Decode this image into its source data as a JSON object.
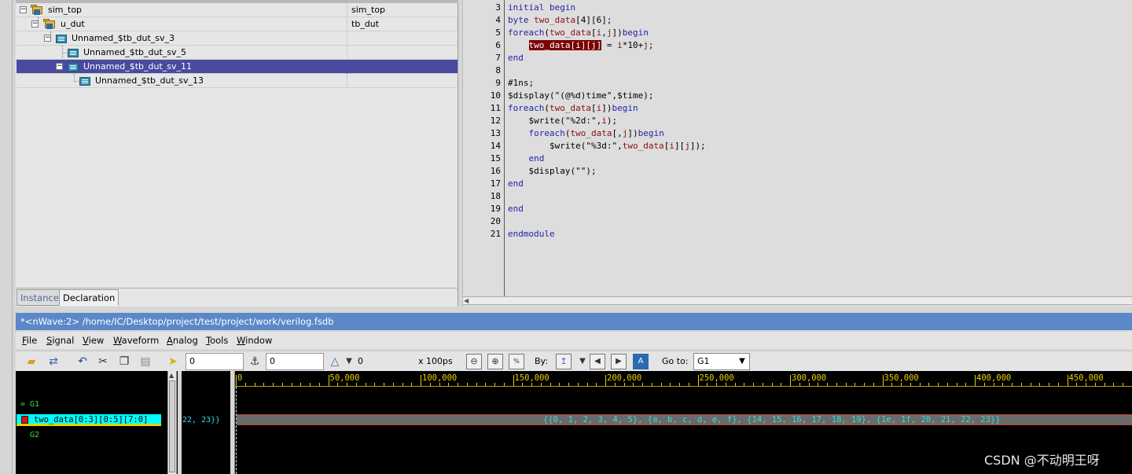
{
  "hierarchy": {
    "rows": [
      {
        "instance": "sim_top",
        "module": "sim_top"
      },
      {
        "instance": "u_dut",
        "module": "tb_dut"
      },
      {
        "instance": "Unnamed_$tb_dut_sv_3",
        "module": ""
      },
      {
        "instance": "Unnamed_$tb_dut_sv_5",
        "module": ""
      },
      {
        "instance": "Unnamed_$tb_dut_sv_11",
        "module": ""
      },
      {
        "instance": "Unnamed_$tb_dut_sv_13",
        "module": ""
      }
    ],
    "tabs": {
      "instance": "Instance",
      "declaration": "Declaration"
    }
  },
  "source": {
    "lines": [
      {
        "n": "3"
      },
      {
        "n": "4"
      },
      {
        "n": "5"
      },
      {
        "n": "6"
      },
      {
        "n": "7"
      },
      {
        "n": "8"
      },
      {
        "n": "9"
      },
      {
        "n": "10"
      },
      {
        "n": "11"
      },
      {
        "n": "12"
      },
      {
        "n": "13"
      },
      {
        "n": "14"
      },
      {
        "n": "15"
      },
      {
        "n": "16"
      },
      {
        "n": "17"
      },
      {
        "n": "18"
      },
      {
        "n": "19"
      },
      {
        "n": "20"
      },
      {
        "n": "21"
      }
    ],
    "code": {
      "l3": "initial begin",
      "l4a": "byte ",
      "l4b": "two_data",
      "l4c": "[4][6];",
      "l5a": "foreach",
      "l5b": "(",
      "l5c": "two_data",
      "l5d": "[",
      "l5e": "i",
      "l5f": ",",
      "l5g": "j",
      "l5h": "])",
      "l5i": "begin",
      "l6a": "    ",
      "l6b": "two_data[i][j]",
      "l6c": " = ",
      "l6d": "i",
      "l6e": "*10+",
      "l6f": "j",
      "l6g": ";",
      "l7": "end",
      "l9": "#1ns;",
      "l10a": "$display(\"(@%d)time\",",
      "l10b": "$time",
      "l10c": ");",
      "l11a": "foreach",
      "l11b": "(",
      "l11c": "two_data",
      "l11d": "[",
      "l11e": "i",
      "l11f": "])",
      "l11g": "begin",
      "l12a": "    $write(\"%2d:\",",
      "l12b": "i",
      "l12c": ");",
      "l13a": "    ",
      "l13b": "foreach",
      "l13c": "(",
      "l13d": "two_data",
      "l13e": "[,",
      "l13f": "j",
      "l13g": "])",
      "l13h": "begin",
      "l14a": "        $write(\"%3d:\",",
      "l14b": "two_data",
      "l14c": "[",
      "l14d": "i",
      "l14e": "][",
      "l14f": "j",
      "l14g": "]",
      "l14h": ");",
      "l15a": "    ",
      "l15b": "end",
      "l16": "    $display(\"\");",
      "l17": "end",
      "l19": "end",
      "l21": "endmodule"
    }
  },
  "nwave": {
    "title": "*<nWave:2> /home/IC/Desktop/project/test/project/work/verilog.fsdb",
    "menus": [
      {
        "pre": "",
        "u": "F",
        "post": "ile"
      },
      {
        "pre": "",
        "u": "S",
        "post": "ignal"
      },
      {
        "pre": "",
        "u": "V",
        "post": "iew"
      },
      {
        "pre": "",
        "u": "W",
        "post": "aveform"
      },
      {
        "pre": "",
        "u": "A",
        "post": "nalog"
      },
      {
        "pre": "",
        "u": "T",
        "post": "ools"
      },
      {
        "pre": "",
        "u": "W",
        "post": "indow"
      }
    ],
    "toolbar": {
      "cursor_time": "0",
      "marker_time": "0",
      "delta": "0",
      "scale": "x 100ps",
      "by_label": "By:",
      "goto_label": "Go to:",
      "goto_value": "G1"
    },
    "signals": {
      "group1": "= G1",
      "signal_name": "two_data[0:3][0:5][7:0]",
      "group2": "G2",
      "value_column": "22, 23}}"
    },
    "ruler": {
      "labels": [
        "0",
        "50,000",
        "100,000",
        "150,000",
        "200,000",
        "250,000",
        "300,000",
        "350,000",
        "400,000",
        "450,000"
      ]
    },
    "bus_value": "{{0, 1, 2, 3, 4, 5}, {a, b, c, d, e, f}, {14, 15, 16, 17, 18, 19}, {1e, 1f, 20, 21, 22, 23}}"
  },
  "colors": {
    "selection": "#4a4aa0",
    "keyword": "#2222aa",
    "identifier": "#8a1010",
    "highlight": "#7a0000",
    "title_bar": "#5a88c8",
    "signal_highlight": "#00ffff",
    "ruler": "#e8d000",
    "group_text": "#3ae03a",
    "bus_text": "#3adada"
  },
  "watermark": "CSDN @不动明王呀"
}
